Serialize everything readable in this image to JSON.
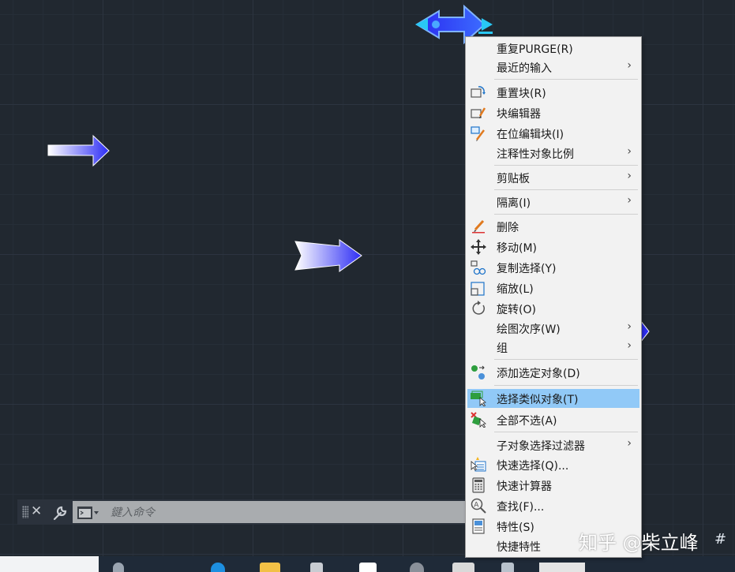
{
  "command_line": {
    "placeholder": "鍵入命令"
  },
  "context_menu": {
    "items": [
      {
        "label": "重复PURGE(R)",
        "icon": "",
        "submenu": false
      },
      {
        "label": "最近的输入",
        "icon": "",
        "submenu": true
      },
      {
        "label": "重置块(R)",
        "icon": "block-reset-icon",
        "submenu": false
      },
      {
        "label": "块编辑器",
        "icon": "block-editor-icon",
        "submenu": false
      },
      {
        "label": "在位编辑块(I)",
        "icon": "edit-in-place-icon",
        "submenu": false
      },
      {
        "label": "注释性对象比例",
        "icon": "",
        "submenu": true
      },
      {
        "label": "剪贴板",
        "icon": "",
        "submenu": true
      },
      {
        "label": "隔离(I)",
        "icon": "",
        "submenu": true
      },
      {
        "label": "删除",
        "icon": "erase-icon",
        "submenu": false
      },
      {
        "label": "移动(M)",
        "icon": "move-icon",
        "submenu": false
      },
      {
        "label": "复制选择(Y)",
        "icon": "copy-icon",
        "submenu": false
      },
      {
        "label": "缩放(L)",
        "icon": "scale-icon",
        "submenu": false
      },
      {
        "label": "旋转(O)",
        "icon": "rotate-icon",
        "submenu": false
      },
      {
        "label": "绘图次序(W)",
        "icon": "",
        "submenu": true
      },
      {
        "label": "组",
        "icon": "",
        "submenu": true
      },
      {
        "label": "添加选定对象(D)",
        "icon": "add-selected-icon",
        "submenu": false
      },
      {
        "label": "选择类似对象(T)",
        "icon": "select-similar-icon",
        "submenu": false,
        "highlighted": true
      },
      {
        "label": "全部不选(A)",
        "icon": "deselect-all-icon",
        "submenu": false
      },
      {
        "label": "子对象选择过滤器",
        "icon": "",
        "submenu": true
      },
      {
        "label": "快速选择(Q)...",
        "icon": "quick-select-icon",
        "submenu": false
      },
      {
        "label": "快速计算器",
        "icon": "calculator-icon",
        "submenu": false
      },
      {
        "label": "查找(F)...",
        "icon": "find-icon",
        "submenu": false
      },
      {
        "label": "特性(S)",
        "icon": "properties-icon",
        "submenu": false
      },
      {
        "label": "快捷特性",
        "icon": "",
        "submenu": false
      }
    ],
    "submenu_arrow": "›"
  },
  "watermark": {
    "text": "知乎 @柴立峰",
    "grid_glyph": "#"
  },
  "colors": {
    "canvas_bg": "#212830",
    "highlight": "#91c9f7",
    "menu_bg": "#f2f2f2",
    "arrow_blue": "#3232ff"
  }
}
